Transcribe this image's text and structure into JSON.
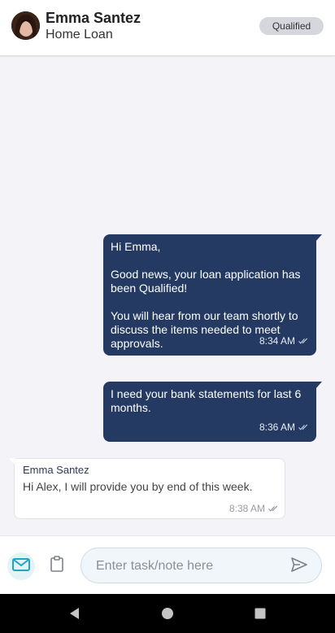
{
  "header": {
    "contact_name": "Emma Santez",
    "subtitle": "Home Loan",
    "status_badge": "Qualified"
  },
  "messages": [
    {
      "direction": "outgoing",
      "text": "Hi Emma,\n\nGood news, your loan application has been Qualified!\n\nYou will hear from our team shortly to discuss the items needed to meet approvals.",
      "time": "8:34 AM",
      "status_icon": "double-check-icon"
    },
    {
      "direction": "outgoing",
      "text": "I need your bank statements for last 6 months.",
      "time": "8:36 AM",
      "status_icon": "double-check-icon"
    },
    {
      "direction": "incoming",
      "sender": "Emma Santez",
      "text": "Hi Alex, I will provide you by end of this week.",
      "time": "8:38 AM",
      "status_icon": "double-check-icon"
    }
  ],
  "composer": {
    "placeholder": "Enter task/note here",
    "value": "",
    "icons": [
      "mail-icon",
      "clipboard-icon",
      "send-icon"
    ]
  },
  "nav": {
    "icons": [
      "back-icon",
      "home-icon",
      "recents-icon"
    ]
  },
  "colors": {
    "outgoing_bubble": "#243a63",
    "background": "#f4f4f8",
    "badge": "#d6d7dc",
    "mail_button": "#e4f3f6"
  }
}
